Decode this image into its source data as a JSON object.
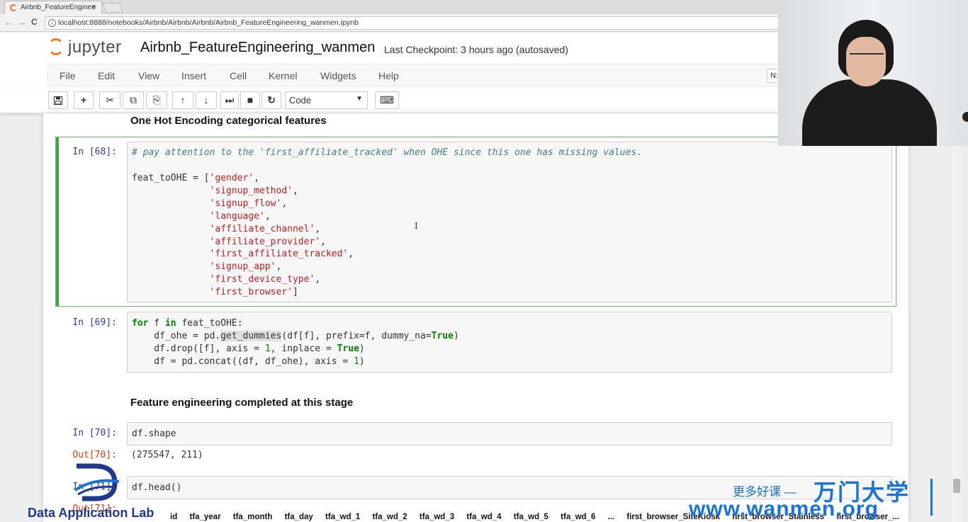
{
  "browser": {
    "tab_title": "Airbnb_FeatureEnginee",
    "tab_close": "×",
    "url": "localhost:8888/notebooks/Airbnb/Airbnb/Airbnb/Airbnb_FeatureEngineering_wanmen.ipynb",
    "back_icon": "←",
    "forward_icon": "→",
    "reload_icon": "C"
  },
  "jupyter": {
    "logo_text": "jupyter",
    "notebook_name": "Airbnb_FeatureEngineering_wanmen",
    "checkpoint": "Last Checkpoint: 3 hours ago (autosaved)",
    "kernel_indicator": "N:"
  },
  "menu": {
    "items": [
      "File",
      "Edit",
      "View",
      "Insert",
      "Cell",
      "Kernel",
      "Widgets",
      "Help"
    ]
  },
  "toolbar": {
    "save_icon": "save-icon",
    "buttons": [
      "+",
      "✂",
      "⧉",
      "⎘",
      "↑",
      "↓",
      "⏭",
      "■",
      "↻",
      "⌨"
    ],
    "cell_type": "Code",
    "cell_type_caret": "▼"
  },
  "cells": {
    "md1": "One Hot Encoding categorical features",
    "c68_prompt": "In  [68]:",
    "c68_comment": "# pay attention to the 'first_affiliate_tracked' when OHE since this one has missing values.",
    "c68_lines": [
      {
        "pre": "feat_toOHE = [",
        "str": "'gender'",
        "post": ","
      },
      {
        "pre": "              ",
        "str": "'signup_method'",
        "post": ","
      },
      {
        "pre": "              ",
        "str": "'signup_flow'",
        "post": ","
      },
      {
        "pre": "              ",
        "str": "'language'",
        "post": ","
      },
      {
        "pre": "              ",
        "str": "'affiliate_channel'",
        "post": ","
      },
      {
        "pre": "              ",
        "str": "'affiliate_provider'",
        "post": ","
      },
      {
        "pre": "              ",
        "str": "'first_affiliate_tracked'",
        "post": ","
      },
      {
        "pre": "              ",
        "str": "'signup_app'",
        "post": ","
      },
      {
        "pre": "              ",
        "str": "'first_device_type'",
        "post": ","
      },
      {
        "pre": "              ",
        "str": "'first_browser'",
        "post": "]"
      }
    ],
    "c69_prompt": "In  [69]:",
    "c69": {
      "l1_k1": "for",
      "l1_mid": " f ",
      "l1_k2": "in",
      "l1_end": " feat_toOHE:",
      "l2_a": "    df_ohe = pd.",
      "l2_hl": "get_dummies",
      "l2_b": "(df[f], prefix=f, dummy_na=",
      "l2_true": "True",
      "l2_c": ")",
      "l3_a": "    df.drop([f], axis = ",
      "l3_n": "1",
      "l3_b": ", inplace = ",
      "l3_true": "True",
      "l3_c": ")",
      "l4_a": "    df = pd.concat((df, df_ohe), axis = ",
      "l4_n": "1",
      "l4_c": ")"
    },
    "md2": "Feature engineering completed at this stage",
    "c70_prompt": "In  [70]:",
    "c70_code": "df.shape",
    "c70_out_prompt": "Out[70]:",
    "c70_out": "(275547, 211)",
    "c71_prompt": "In  [71]:",
    "c71_code": "df.head()",
    "c71_out_prompt": "Out[71]:"
  },
  "dataframe_header": [
    "id",
    "tfa_year",
    "tfa_month",
    "tfa_day",
    "tfa_wd_1",
    "tfa_wd_2",
    "tfa_wd_3",
    "tfa_wd_4",
    "tfa_wd_5",
    "tfa_wd_6",
    "...",
    "first_browser_SiteKiosk",
    "first_browser_Stainless",
    "first_browser_..."
  ],
  "watermark": {
    "lab_name": "Data Application Lab",
    "cn_small": "更多好课 —",
    "cn_big": "万门大学",
    "site": "www.wanmen.org"
  },
  "colors": {
    "accent_green": "#42a545",
    "prompt_blue": "#303f9f",
    "out_red": "#d84315",
    "jupyter_orange": "#f37726",
    "wanmen_blue": "#1a73d9"
  }
}
